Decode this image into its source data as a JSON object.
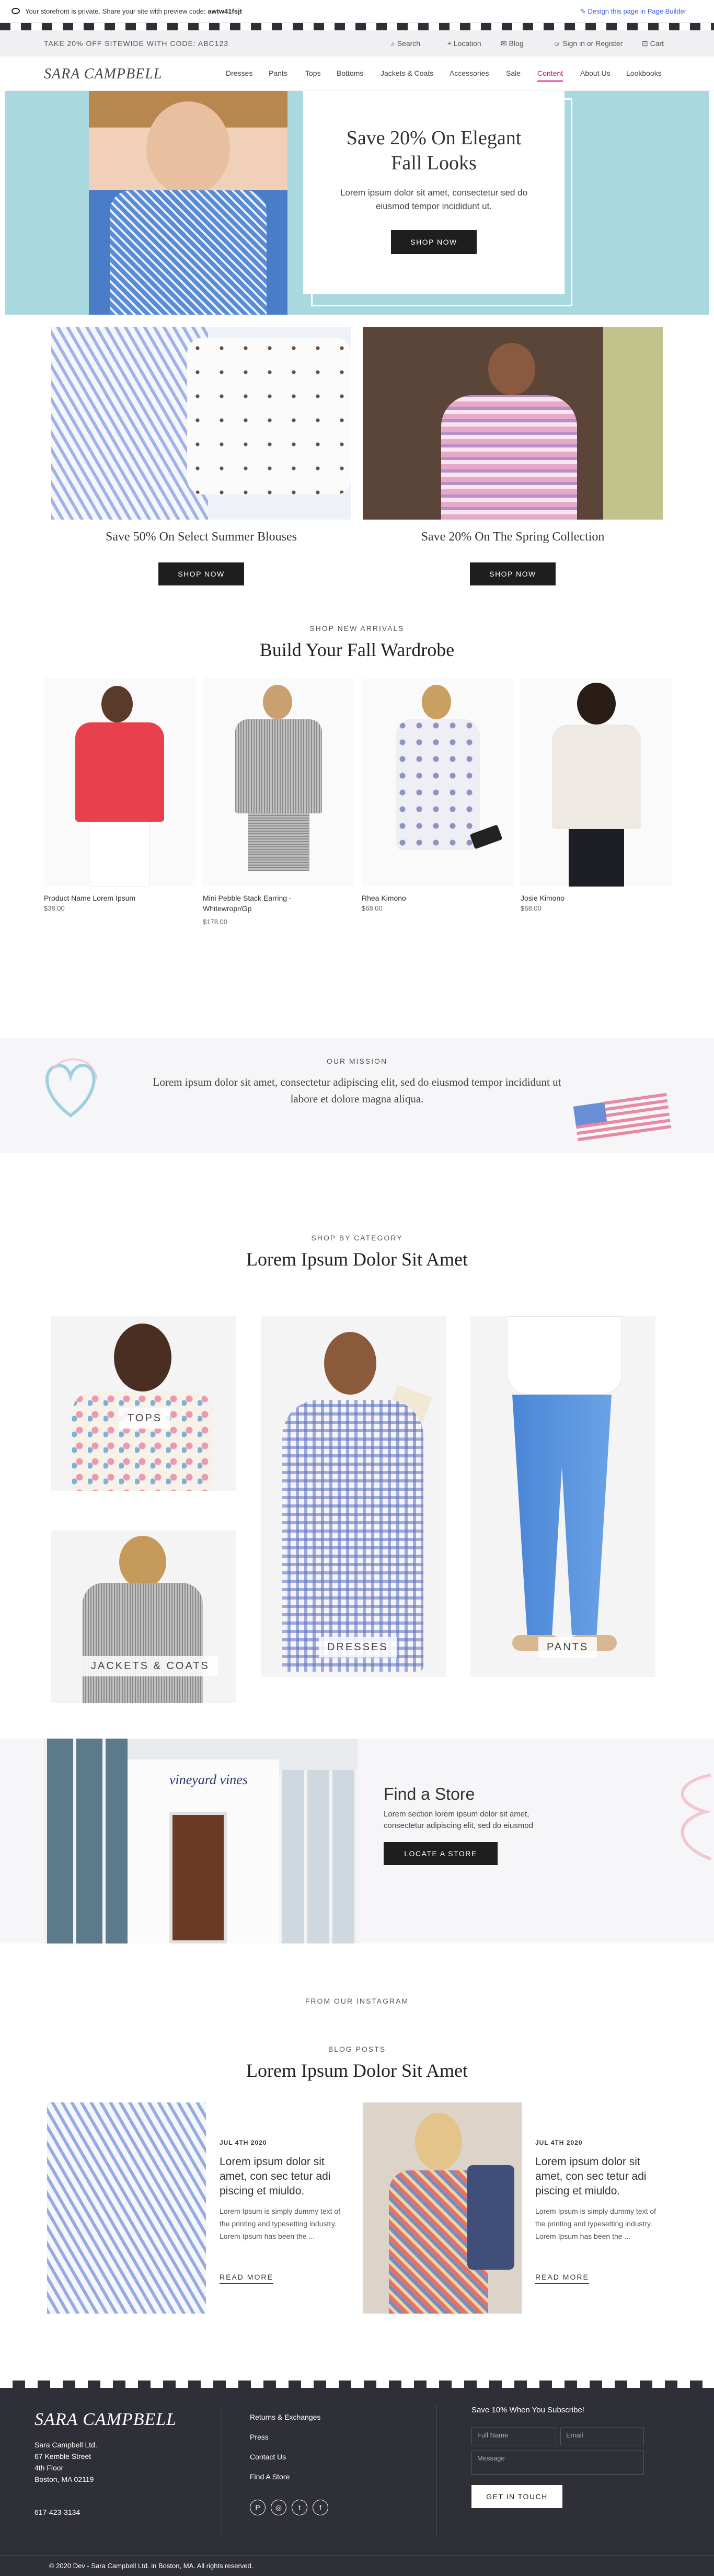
{
  "preview_bar": {
    "message": "Your storefront is private. Share your site with preview code:",
    "code": "awtw41fsjt",
    "link": "Design this page in Page Builder"
  },
  "promo": {
    "text": "TAKE 20% OFF SITEWIDE WITH CODE: ABC123",
    "search": "Search",
    "location": "Location",
    "blog": "Blog",
    "account": "Sign in or Register",
    "cart": "Cart"
  },
  "brand": {
    "logo": "SARA CAMPBELL"
  },
  "nav": {
    "items": [
      "Dresses",
      "Pants",
      "Tops",
      "Bottoms",
      "Jackets & Coats",
      "Accessories",
      "Sale",
      "Content",
      "About Us",
      "Lookbooks"
    ]
  },
  "hero": {
    "title": "Save 20% On Elegant Fall Looks",
    "body": "Lorem ipsum dolor sit amet, consectetur sed do eiusmod tempor incididunt ut.",
    "button": "SHOP NOW"
  },
  "promos": [
    {
      "title": "Save 50% On Select Summer Blouses",
      "button": "SHOP NOW"
    },
    {
      "title": "Save 20% On The Spring Collection",
      "button": "SHOP NOW"
    }
  ],
  "arrivals": {
    "eyebrow": "SHOP NEW ARRIVALS",
    "title": "Build Your Fall Wardrobe",
    "products": [
      {
        "name": "Product Name Lorem Ipsum",
        "price": "$38.00"
      },
      {
        "name": "Mini Pebble Stack Earring - Whitewropr/Gp",
        "price": "$178.00"
      },
      {
        "name": "Rhea Kimono",
        "price": "$68.00"
      },
      {
        "name": "Josie Kimono",
        "price": "$68.00"
      }
    ]
  },
  "mission": {
    "eyebrow": "OUR MISSION",
    "body": "Lorem ipsum dolor sit amet, consectetur adipiscing elit, sed do eiusmod tempor incididunt ut labore et dolore magna aliqua."
  },
  "categories": {
    "eyebrow": "SHOP BY CATEGORY",
    "title": "Lorem Ipsum Dolor Sit Amet",
    "items": [
      "TOPS",
      "JACKETS & COATS",
      "DRESSES",
      "PANTS"
    ]
  },
  "store": {
    "sign": "vineyard vines",
    "title": "Find a Store",
    "body": "Lorem section lorem ipsum dolor sit amet, consectetur adipiscing elit, sed do eiusmod",
    "button": "LOCATE A STORE"
  },
  "instagram": {
    "eyebrow": "FROM OUR INSTAGRAM"
  },
  "blog": {
    "eyebrow": "BLOG POSTS",
    "title": "Lorem Ipsum Dolor Sit Amet",
    "posts": [
      {
        "date": "JUL 4TH 2020",
        "title": "Lorem ipsum dolor sit amet, con sec tetur adi piscing et miuldo.",
        "body": "Lorem Ipsum is simply dummy text of the printing and typesetting industry. Lorem Ipsum has been the ...",
        "link": "READ MORE"
      },
      {
        "date": "JUL 4TH 2020",
        "title": "Lorem ipsum dolor sit amet, con sec tetur adi piscing et miuldo.",
        "body": "Lorem Ipsum is simply dummy text of the printing and typesetting industry. Lorem Ipsum has been the ...",
        "link": "READ MORE"
      }
    ]
  },
  "footer": {
    "logo": "SARA CAMPBELL",
    "address": [
      "Sara Campbell Ltd.",
      "67 Kemble Street",
      "4th Floor",
      "Boston, MA 02119"
    ],
    "phone": "617-423-3134",
    "links": [
      "Returns & Exchanges",
      "Press",
      "Contact Us",
      "Find A Store"
    ],
    "subscribe_title": "Save 10% When You Subscribe!",
    "full_name": "Full Name",
    "email": "Email",
    "message": "Message",
    "button": "GET IN TOUCH",
    "copyright": "© 2020 Dev - Sara Campbell Ltd. in Boston, MA. All rights reserved."
  },
  "colors": {
    "accent": "#e6007e",
    "hero_bg": "#a9d8de",
    "footer_bg": "#2f3037"
  }
}
